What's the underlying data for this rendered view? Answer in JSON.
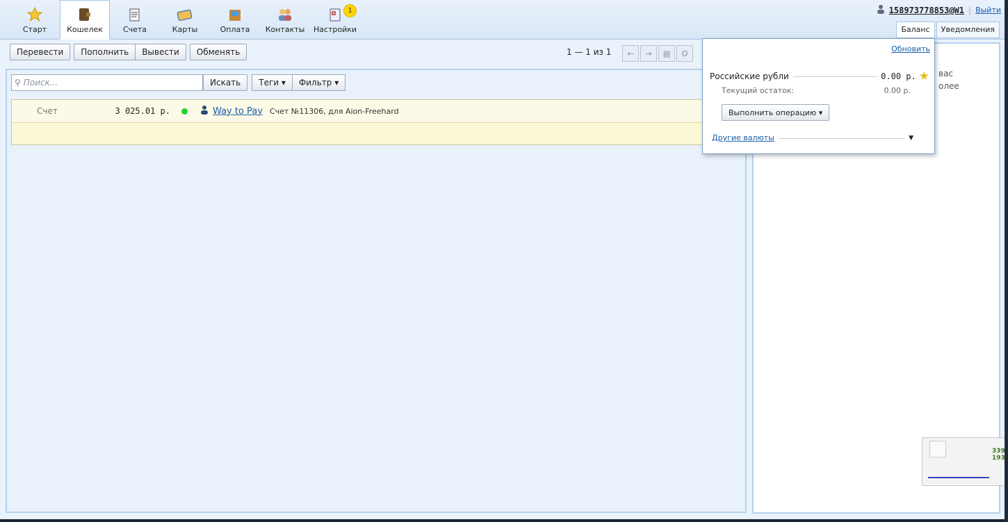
{
  "nav": {
    "tabs": [
      {
        "label": "Старт",
        "icon": "star-icon"
      },
      {
        "label": "Кошелек",
        "icon": "wallet-icon",
        "active": true
      },
      {
        "label": "Счета",
        "icon": "invoices-icon"
      },
      {
        "label": "Карты",
        "icon": "cards-icon"
      },
      {
        "label": "Оплата",
        "icon": "payment-icon"
      },
      {
        "label": "Контакты",
        "icon": "contacts-icon"
      },
      {
        "label": "Настройки",
        "icon": "settings-icon",
        "badge": "1"
      }
    ]
  },
  "user": {
    "id": "158973778853@W1",
    "logout": "Выйти"
  },
  "right_tabs": {
    "balance": "Баланс",
    "notifications": "Уведомления"
  },
  "toolbar": {
    "transfer": "Перевести",
    "topup": "Пополнить",
    "withdraw": "Вывести",
    "exchange": "Обменять"
  },
  "pager": {
    "text": "1 — 1 из 1",
    "prev": "←",
    "next": "→",
    "more": "О"
  },
  "search": {
    "placeholder": "Поиск...",
    "button": "Искать",
    "tags": "Теги ▾",
    "filter": "Фильтр ▾"
  },
  "transactions": [
    {
      "type": "Счет",
      "amount": "3 025.01 р.",
      "status_color": "#24d12b",
      "counterparty": "Way to Pay",
      "description": "Счет №11306, для Aion-Freehard"
    }
  ],
  "side": {
    "line1": "вас",
    "line2": "олее"
  },
  "balance_popup": {
    "refresh": "Обновить",
    "currency": "Российские рубли",
    "amount": "0.00 р.",
    "current_label": "Текущий остаток:",
    "current_amount": "0.00 р.",
    "operation_button": "Выполнить операцию ▾",
    "other_currencies": "Другие валюты"
  },
  "thumbnail": {
    "line1": "339",
    "line2": "193"
  },
  "colors": {
    "accent": "#1b5ea8",
    "tab_border": "#a9c3e2",
    "row_bg": "#fbf8d6"
  }
}
